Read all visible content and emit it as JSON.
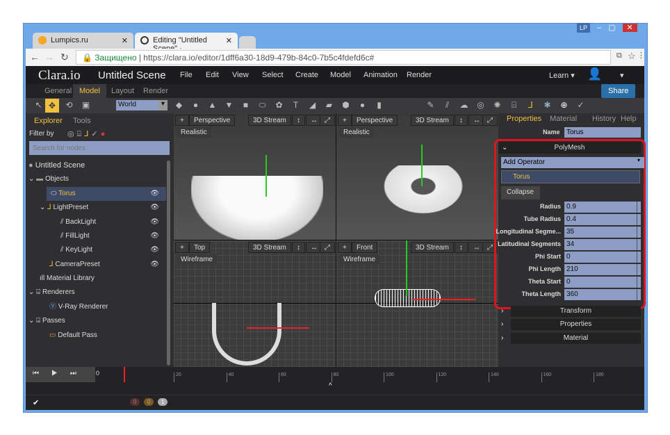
{
  "browser": {
    "tabs": [
      {
        "title": "Lumpics.ru"
      },
      {
        "title": "Editing \"Untitled Scene\" ·"
      }
    ],
    "user_badge": "LP",
    "security": "Защищено",
    "url": "https://clara.io/editor/1dff6a30-18d9-479b-84c0-7b5c4fdefd6c#"
  },
  "app": {
    "logo": "Clara.io",
    "scene_title": "Untitled Scene",
    "menu": [
      "File",
      "Edit",
      "View",
      "Select",
      "Create",
      "Model",
      "Animation",
      "Render"
    ],
    "learn": "Learn",
    "share": "Share",
    "subtabs": [
      "General",
      "Model",
      "Layout",
      "Render"
    ],
    "active_subtab": "Model",
    "coord_space": "World"
  },
  "explorer": {
    "tabs": [
      "Explorer",
      "Tools"
    ],
    "filter_label": "Filter by",
    "search_placeholder": "Search for nodes",
    "nodes": [
      "Untitled Scene",
      "Objects",
      "Torus",
      "LightPreset",
      "BackLight",
      "FillLight",
      "KeyLight",
      "CameraPreset",
      "Material Library",
      "Renderers",
      "V-Ray Renderer",
      "Passes",
      "Default Pass"
    ]
  },
  "viewports": [
    {
      "camera": "Perspective",
      "stream": "3D Stream",
      "mode": "Realistic"
    },
    {
      "camera": "Perspective",
      "stream": "3D Stream",
      "mode": "Realistic"
    },
    {
      "camera": "Top",
      "stream": "3D Stream",
      "mode": "Wireframe"
    },
    {
      "camera": "Front",
      "stream": "3D Stream",
      "mode": "Wireframe"
    }
  ],
  "properties": {
    "tabs": [
      "Properties",
      "Material",
      "History",
      "Help"
    ],
    "name_label": "Name",
    "name_value": "Torus",
    "section": "PolyMesh",
    "add_operator": "Add Operator",
    "operator": "Torus",
    "collapse": "Collapse",
    "params": [
      {
        "label": "Radius",
        "value": "0.9"
      },
      {
        "label": "Tube Radius",
        "value": "0.4"
      },
      {
        "label": "Longitudinal Segme...",
        "value": "35"
      },
      {
        "label": "Latitudinal Segments",
        "value": "34"
      },
      {
        "label": "Phi Start",
        "value": "0"
      },
      {
        "label": "Phi Length",
        "value": "210"
      },
      {
        "label": "Theta Start",
        "value": "0"
      },
      {
        "label": "Theta Length",
        "value": "360"
      }
    ],
    "sections": [
      "Transform",
      "Properties",
      "Material"
    ]
  },
  "timeline": {
    "current": "0",
    "ticks": [
      "20",
      "40",
      "60",
      "80",
      "100",
      "120",
      "140",
      "160",
      "180"
    ],
    "badges": [
      "0",
      "0",
      "1"
    ]
  },
  "colors": {
    "accent": "#f0c040",
    "highlight": "#e0141e",
    "share": "#2a6fa8"
  }
}
